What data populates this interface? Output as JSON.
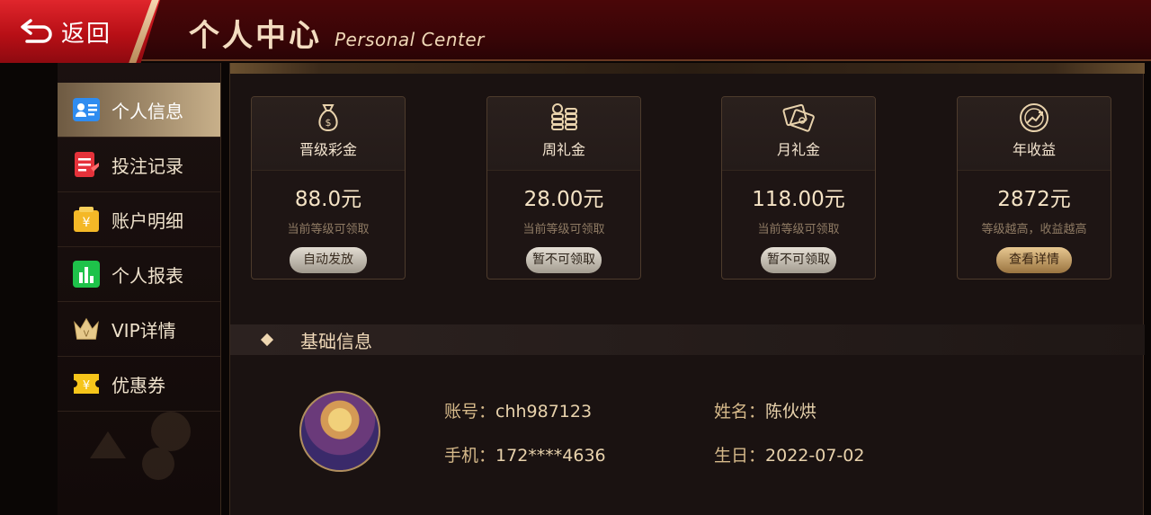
{
  "header": {
    "back_label": "返回",
    "title_cn": "个人中心",
    "title_en": "Personal Center"
  },
  "sidebar": {
    "items": [
      {
        "label": "个人信息",
        "icon": "profile-card-icon",
        "active": true
      },
      {
        "label": "投注记录",
        "icon": "bet-record-icon",
        "active": false
      },
      {
        "label": "账户明细",
        "icon": "wallet-icon",
        "active": false
      },
      {
        "label": "个人报表",
        "icon": "report-chart-icon",
        "active": false
      },
      {
        "label": "VIP详情",
        "icon": "crown-icon",
        "active": false
      },
      {
        "label": "优惠券",
        "icon": "coupon-icon",
        "active": false
      }
    ]
  },
  "cards": [
    {
      "title": "晋级彩金",
      "amount": "88.0元",
      "note": "当前等级可领取",
      "button": "自动发放",
      "icon": "money-bag-icon"
    },
    {
      "title": "周礼金",
      "amount": "28.00元",
      "note": "当前等级可领取",
      "button": "暂不可领取",
      "icon": "coin-stack-icon"
    },
    {
      "title": "月礼金",
      "amount": "118.00元",
      "note": "当前等级可领取",
      "button": "暂不可领取",
      "icon": "cash-notes-icon"
    },
    {
      "title": "年收益",
      "amount": "2872元",
      "note": "等级越高，收益越高",
      "button": "查看详情",
      "icon": "growth-coin-icon"
    }
  ],
  "basic_info": {
    "section_title": "基础信息",
    "account_label": "账号：",
    "account_value": "chh987123",
    "name_label": "姓名：",
    "name_value": "陈伙烘",
    "phone_label": "手机：",
    "phone_value": "172****4636",
    "birthday_label": "生日：",
    "birthday_value": "2022-07-02"
  },
  "colors": {
    "header_red": "#4a0608",
    "back_red": "#d21d24",
    "gold_accent": "#e8c891",
    "panel_bg": "#1a1211"
  }
}
